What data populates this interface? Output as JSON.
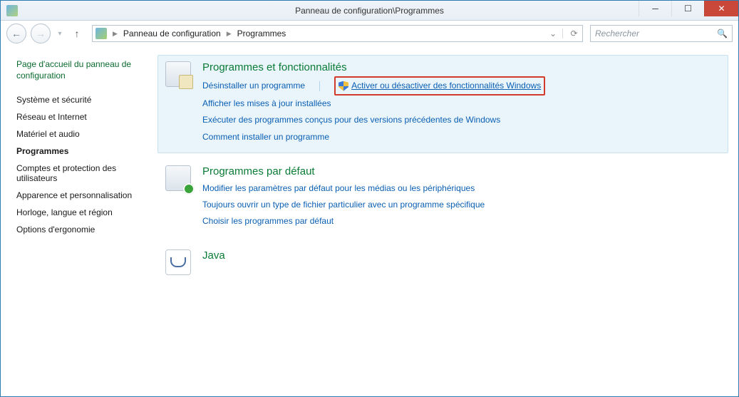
{
  "window": {
    "title": "Panneau de configuration\\Programmes"
  },
  "toolbar": {
    "breadcrumb1": "Panneau de configuration",
    "breadcrumb2": "Programmes",
    "search_placeholder": "Rechercher"
  },
  "sidebar": {
    "heading": "Page d'accueil du panneau de configuration",
    "items": [
      {
        "label": "Système et sécurité"
      },
      {
        "label": "Réseau et Internet"
      },
      {
        "label": "Matériel et audio"
      },
      {
        "label": "Programmes",
        "active": true
      },
      {
        "label": "Comptes et protection des utilisateurs"
      },
      {
        "label": "Apparence et personnalisation"
      },
      {
        "label": "Horloge, langue et région"
      },
      {
        "label": "Options d'ergonomie"
      }
    ]
  },
  "sections": {
    "progfeat": {
      "title": "Programmes et fonctionnalités",
      "uninstall": "Désinstaller un programme",
      "turn_on_off": "Activer ou désactiver des fonctionnalités Windows",
      "view_updates": "Afficher les mises à jour installées",
      "run_compat": "Exécuter des programmes conçus pour des versions précédentes de Windows",
      "how_install": "Comment installer un programme"
    },
    "defaults": {
      "title": "Programmes par défaut",
      "modify": "Modifier les paramètres par défaut pour les médias ou les périphériques",
      "always_open": "Toujours ouvrir un type de fichier particulier avec un programme spécifique",
      "choose": "Choisir les programmes par défaut"
    },
    "java": {
      "title": "Java"
    }
  }
}
